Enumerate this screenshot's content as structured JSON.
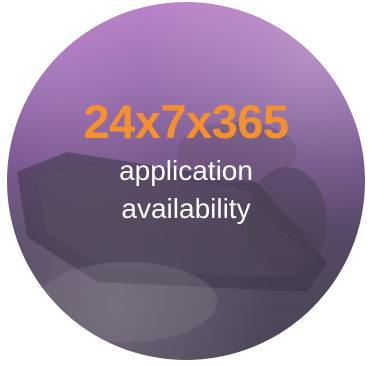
{
  "badge": {
    "headline": "24x7x365",
    "caption_line1": "application",
    "caption_line2": "availability",
    "headline_color": "#f4912e",
    "caption_color": "#ffffff",
    "background_tint": "purple-gradient-photo"
  }
}
